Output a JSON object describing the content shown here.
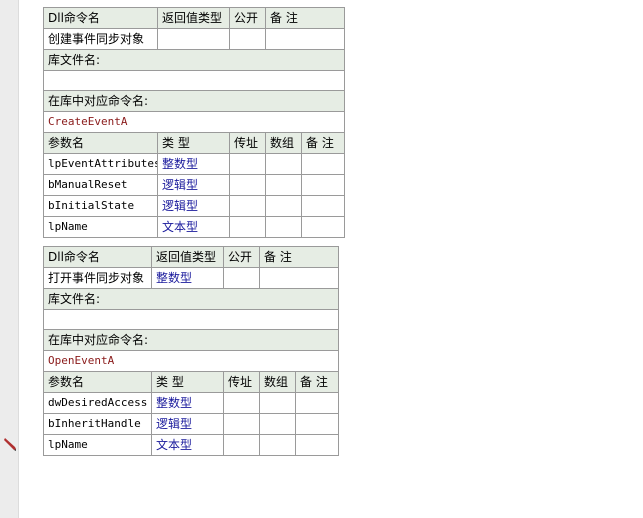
{
  "tables": [
    {
      "header": {
        "col_name": "Dll命令名",
        "col_return": "返回值类型",
        "col_public": "公开",
        "col_note": "备 注"
      },
      "command": {
        "name": "创建事件同步对象",
        "return_type": "",
        "public": "",
        "note": ""
      },
      "lib_label": "库文件名:",
      "lib_value": "",
      "entry_label": "在库中对应命令名:",
      "entry_value": "CreateEventA",
      "param_header": {
        "name": "参数名",
        "type": "类 型",
        "byref": "传址",
        "array": "数组",
        "note": "备 注"
      },
      "params": [
        {
          "name": "lpEventAttributes",
          "type": "整数型"
        },
        {
          "name": "bManualReset",
          "type": "逻辑型"
        },
        {
          "name": "bInitialState",
          "type": "逻辑型"
        },
        {
          "name": "lpName",
          "type": "文本型"
        }
      ]
    },
    {
      "header": {
        "col_name": "Dll命令名",
        "col_return": "返回值类型",
        "col_public": "公开",
        "col_note": "备 注"
      },
      "command": {
        "name": "打开事件同步对象",
        "return_type": "整数型",
        "public": "",
        "note": ""
      },
      "lib_label": "库文件名:",
      "lib_value": "",
      "entry_label": "在库中对应命令名:",
      "entry_value": "OpenEventA",
      "param_header": {
        "name": "参数名",
        "type": "类 型",
        "byref": "传址",
        "array": "数组",
        "note": "备 注"
      },
      "params": [
        {
          "name": "dwDesiredAccess",
          "type": "整数型"
        },
        {
          "name": "bInheritHandle",
          "type": "逻辑型"
        },
        {
          "name": "lpName",
          "type": "文本型"
        }
      ]
    }
  ],
  "gutter_icon": "pencil-icon"
}
